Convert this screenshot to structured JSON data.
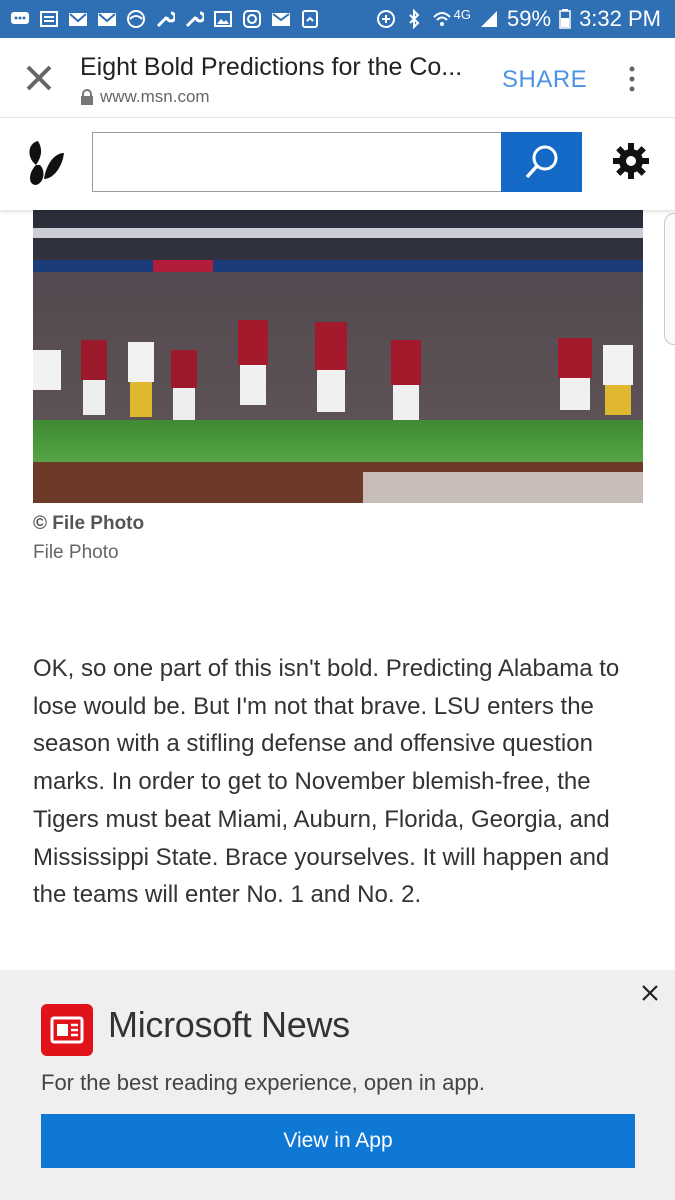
{
  "status_bar": {
    "network": "4G",
    "battery": "59%",
    "time": "3:32 PM",
    "bg_color": "#2f6fb4",
    "left_icons": [
      "chat-icon",
      "news-icon",
      "gmail-icon",
      "gmail-icon",
      "sports-icon",
      "wrench-icon",
      "wrench-icon",
      "image-icon",
      "instagram-icon",
      "mail-icon",
      "card-icon"
    ]
  },
  "browser": {
    "title": "Eight Bold Predictions for the Co...",
    "url": "www.msn.com",
    "share_label": "SHARE"
  },
  "msn": {
    "search_placeholder": "",
    "search_value": "",
    "accent_color": "#1469c7"
  },
  "article": {
    "photo_credit": "© File Photo",
    "photo_caption": "File Photo",
    "body": "OK, so one part of this isn't bold. Predicting Alabama to lose would be. But I'm not that brave. LSU enters the season with a stifling defense and offensive question marks. In order to get to November blemish-free, the Tigers must beat Miami, Auburn, Florida, Georgia, and Mississippi State. Brace yourselves. It will happen and the teams will enter No. 1 and No. 2."
  },
  "app_banner": {
    "title": "Microsoft News",
    "subtitle": "For the best reading experience, open in app.",
    "button_label": "View in App",
    "brand_red": "#e2121a",
    "button_color": "#0f78d4"
  }
}
